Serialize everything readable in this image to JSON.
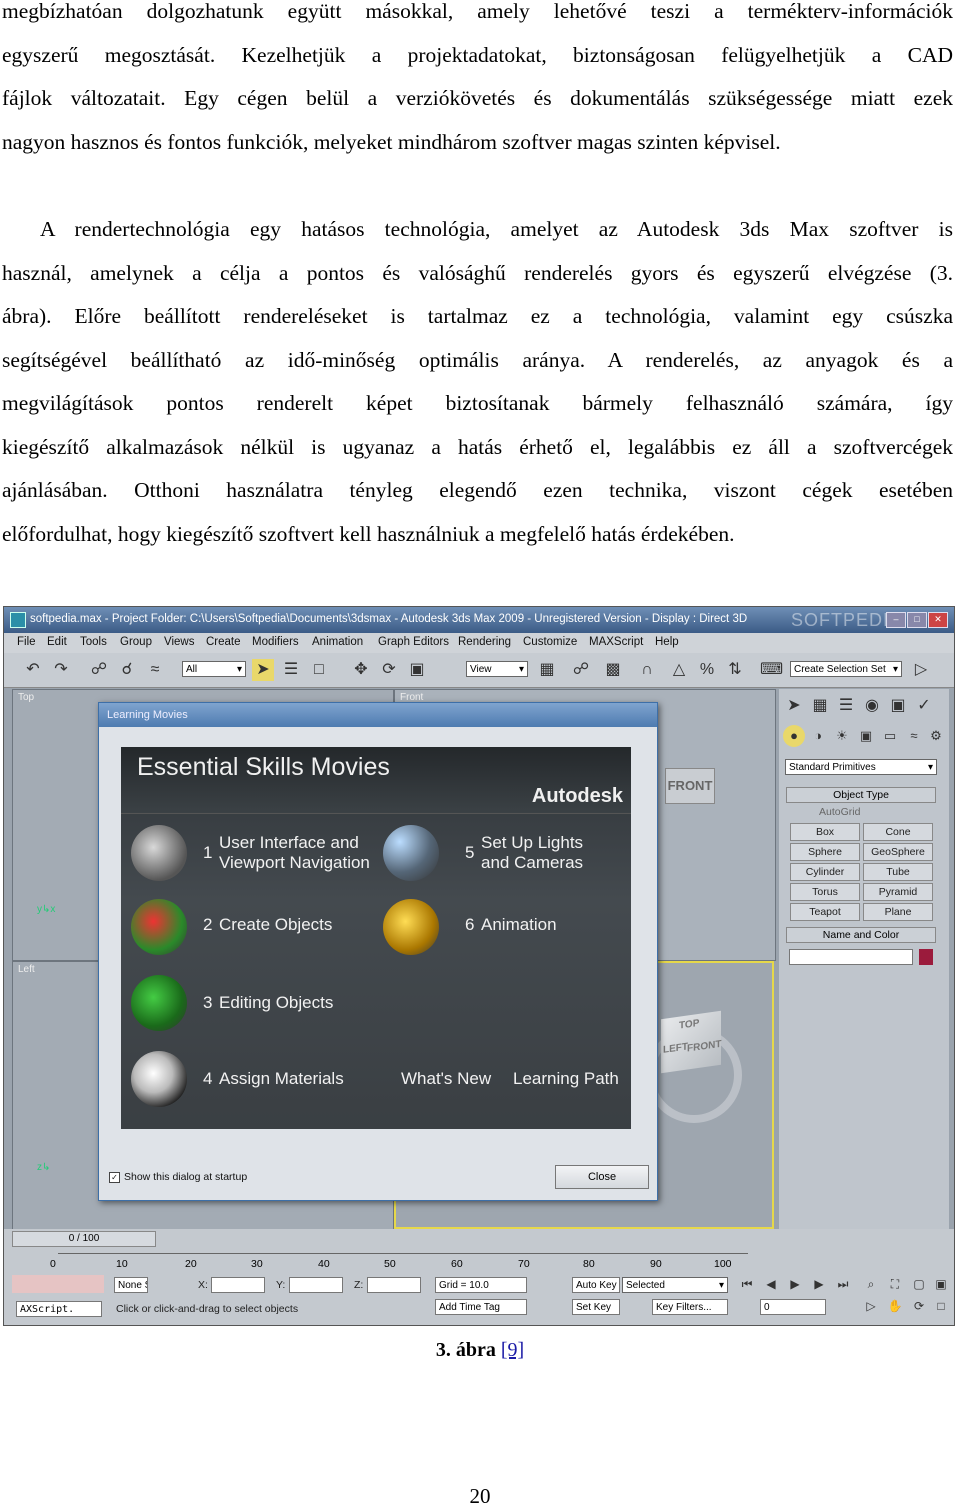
{
  "paragraph1": [
    "megbízhatóan dolgozhatunk együtt másokkal, amely lehetővé teszi a termékterv-információk",
    "egyszerű megosztását. Kezelhetjük a projektadatokat, biztonságosan felügyelhetjük a CAD",
    "fájlok változatait. Egy cégen belül a verziókövetés és dokumentálás szükségessége miatt ezek",
    "nagyon hasznos és fontos funkciók, melyeket mindhárom szoftver magas szinten képvisel."
  ],
  "paragraph2": [
    "A rendertechnológia egy hatásos technológia, amelyet az Autodesk 3ds Max szoftver is",
    "használ, amelynek a célja a pontos és valósághű renderelés gyors és egyszerű elvégzése (3.",
    "ábra). Előre beállított rendereléseket is tartalmaz ez a technológia, valamint egy csúszka",
    "segítségével beállítható az idő-minőség optimális aránya. A renderelés, az anyagok és a",
    "megvilágítások pontos renderelt képet biztosítanak bármely felhasználó számára, így",
    "kiegészítő alkalmazások nélkül is ugyanaz a hatás érhető el, legalábbis ez áll a szoftvercégek",
    "ajánlásában. Otthoni használatra tényleg elegendő ezen technika, viszont cégek esetében",
    "előfordulhat, hogy kiegészítő szoftvert kell használniuk a megfelelő hatás érdekében."
  ],
  "screenshot": {
    "title": "softpedia.max   - Project Folder: C:\\Users\\Softpedia\\Documents\\3dsmax   - Autodesk 3ds Max  2009  - Unregistered Version   - Display : Direct 3D",
    "watermark": "SOFTPEDIA",
    "menu": [
      "File",
      "Edit",
      "Tools",
      "Group",
      "Views",
      "Create",
      "Modifiers",
      "Animation",
      "Graph Editors",
      "Rendering",
      "Customize",
      "MAXScript",
      "Help"
    ],
    "toolbar": {
      "filter": "All",
      "refcoord": "View",
      "selection_set": "Create Selection Set"
    },
    "viewports": {
      "top": "Top",
      "front": "Front",
      "left": "Left"
    },
    "viewcube": {
      "top": "TOP",
      "left": "LEFT",
      "front": "FRONT",
      "front_wall": "FRONT"
    },
    "command_panel": {
      "category": "Standard Primitives",
      "object_type_header": "Object Type",
      "autogrid": "AutoGrid",
      "primitives": [
        "Box",
        "Cone",
        "Sphere",
        "GeoSphere",
        "Cylinder",
        "Tube",
        "Torus",
        "Pyramid",
        "Teapot",
        "Plane"
      ],
      "name_color_header": "Name and Color"
    },
    "dialog": {
      "title": "Learning Movies",
      "movie_title": "Essential Skills Movies",
      "brand": "Autodesk",
      "items": [
        {
          "num": "1",
          "text": "User Interface and\nViewport Navigation"
        },
        {
          "num": "2",
          "text": "Create Objects"
        },
        {
          "num": "3",
          "text": "Editing Objects"
        },
        {
          "num": "4",
          "text": "Assign Materials"
        },
        {
          "num": "5",
          "text": "Set Up Lights\nand Cameras"
        },
        {
          "num": "6",
          "text": "Animation"
        }
      ],
      "whats_new": "What's New",
      "learning_path": "Learning Path",
      "checkbox_label": "Show this dialog at startup",
      "close_label": "Close"
    },
    "timeslider": "0 / 100",
    "ruler_ticks": [
      "0",
      "10",
      "20",
      "30",
      "40",
      "50",
      "60",
      "70",
      "80",
      "90",
      "100"
    ],
    "status": {
      "none": "None S",
      "x": "X:",
      "y": "Y:",
      "z": "Z:",
      "grid": "Grid = 10.0",
      "autokey": "Auto Key",
      "selected": "Selected",
      "setkey": "Set Key",
      "keyfilters": "Key Filters...",
      "frame": "0",
      "maxscript": "AXScript.",
      "prompt": "Click or click-and-drag to select objects",
      "addtimetag": "Add Time Tag"
    },
    "colors": {
      "titlebar": "#4e6f9a",
      "accent_swatch": "#9b1b3c",
      "active_viewport_border": "#e6d84a"
    }
  },
  "caption": {
    "label": "3. ábra",
    "ref": "[9]"
  },
  "page_number": "20"
}
